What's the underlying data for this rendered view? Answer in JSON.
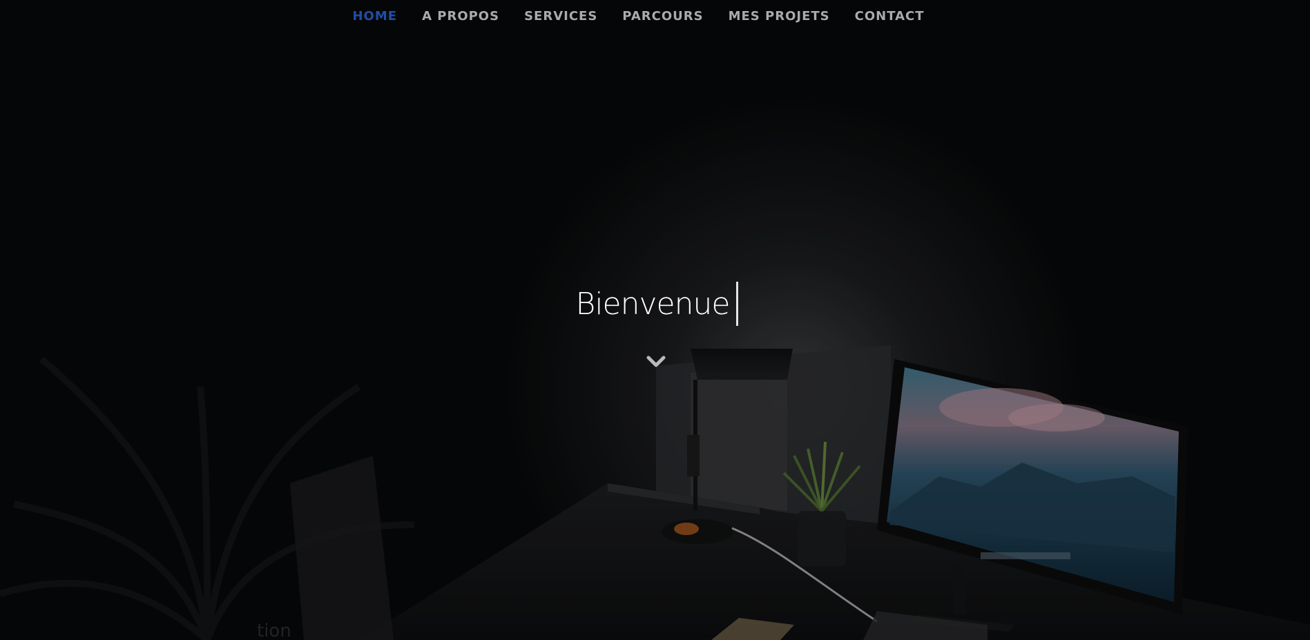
{
  "nav": {
    "items": [
      {
        "label": "HOME",
        "active": true
      },
      {
        "label": "A PROPOS",
        "active": false
      },
      {
        "label": "SERVICES",
        "active": false
      },
      {
        "label": "PARCOURS",
        "active": false
      },
      {
        "label": "MES PROJETS",
        "active": false
      },
      {
        "label": "CONTACT",
        "active": false
      }
    ],
    "active_color": "#1f4fa8",
    "default_color": "#a9abae"
  },
  "hero": {
    "title": "Bienvenue",
    "scroll_icon": "chevron-down-icon"
  },
  "background": {
    "description_icon": "desk-scene-image",
    "poster_text": "tion"
  }
}
